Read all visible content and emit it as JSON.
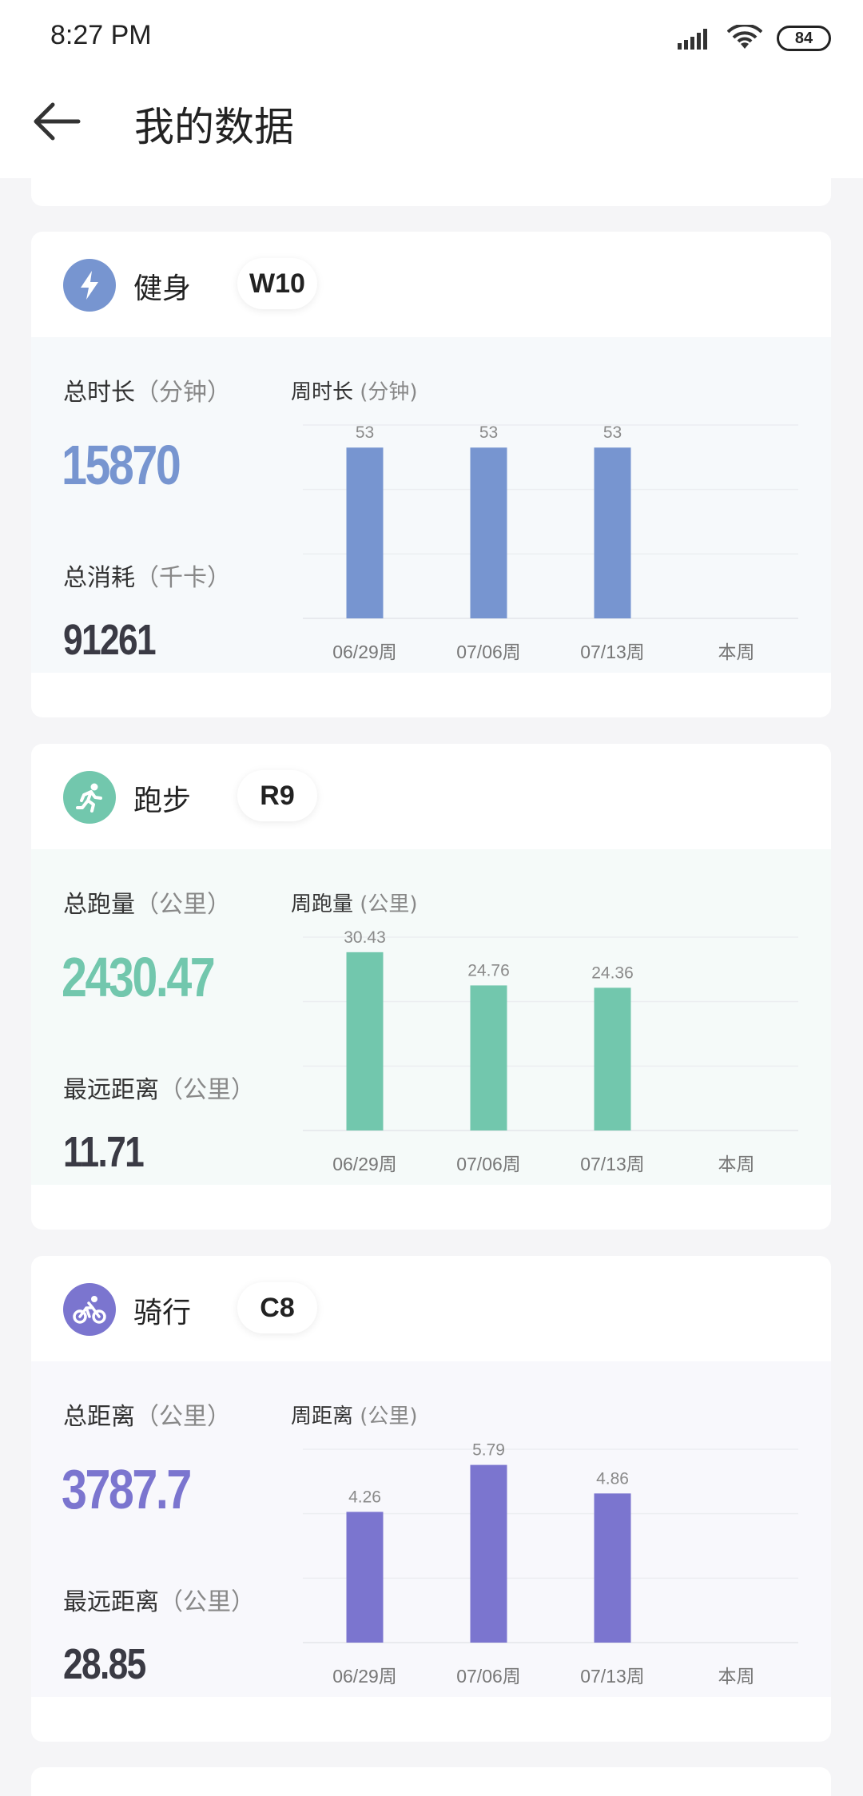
{
  "status_bar": {
    "time": "8:27 PM",
    "battery": "84"
  },
  "header": {
    "title": "我的数据"
  },
  "cards": [
    {
      "name": "健身",
      "level": "W10",
      "color": "#7795d0",
      "tint": "#f6f9fb",
      "icon": "bolt-icon",
      "stat1_label": "总时长",
      "stat1_unit": "（分钟）",
      "stat1_value": "15870",
      "stat2_label": "总消耗",
      "stat2_unit": "（千卡）",
      "stat2_value": "91261",
      "chart_label": "周时长",
      "chart_unit": "(分钟)"
    },
    {
      "name": "跑步",
      "level": "R9",
      "color": "#72c7ad",
      "tint": "#f5faf9",
      "icon": "runner-icon",
      "stat1_label": "总跑量",
      "stat1_unit": "（公里）",
      "stat1_value": "2430.47",
      "stat2_label": "最远距离",
      "stat2_unit": "（公里）",
      "stat2_value": "11.71",
      "chart_label": "周跑量",
      "chart_unit": "(公里)"
    },
    {
      "name": "骑行",
      "level": "C8",
      "color": "#7b75cf",
      "tint": "#f8f8fc",
      "icon": "bicycle-icon",
      "stat1_label": "总距离",
      "stat1_unit": "（公里）",
      "stat1_value": "3787.7",
      "stat2_label": "最远距离",
      "stat2_unit": "（公里）",
      "stat2_value": "28.85",
      "chart_label": "周距离",
      "chart_unit": "(公里)"
    }
  ],
  "chart_data": [
    {
      "type": "bar",
      "title": "周时长 (分钟)",
      "categories": [
        "06/29周",
        "07/06周",
        "07/13周",
        "本周"
      ],
      "values": [
        53,
        53,
        53,
        null
      ],
      "value_labels": [
        "53",
        "53",
        "53",
        ""
      ],
      "ylim": [
        0,
        60
      ],
      "grid": true
    },
    {
      "type": "bar",
      "title": "周跑量 (公里)",
      "categories": [
        "06/29周",
        "07/06周",
        "07/13周",
        "本周"
      ],
      "values": [
        30.43,
        24.76,
        24.36,
        null
      ],
      "value_labels": [
        "30.43",
        "24.76",
        "24.36",
        ""
      ],
      "ylim": [
        0,
        33
      ],
      "grid": true
    },
    {
      "type": "bar",
      "title": "周距离 (公里)",
      "categories": [
        "06/29周",
        "07/06周",
        "07/13周",
        "本周"
      ],
      "values": [
        4.26,
        5.79,
        4.86,
        null
      ],
      "value_labels": [
        "4.26",
        "5.79",
        "4.86",
        ""
      ],
      "ylim": [
        0,
        6.3
      ],
      "grid": true
    }
  ]
}
